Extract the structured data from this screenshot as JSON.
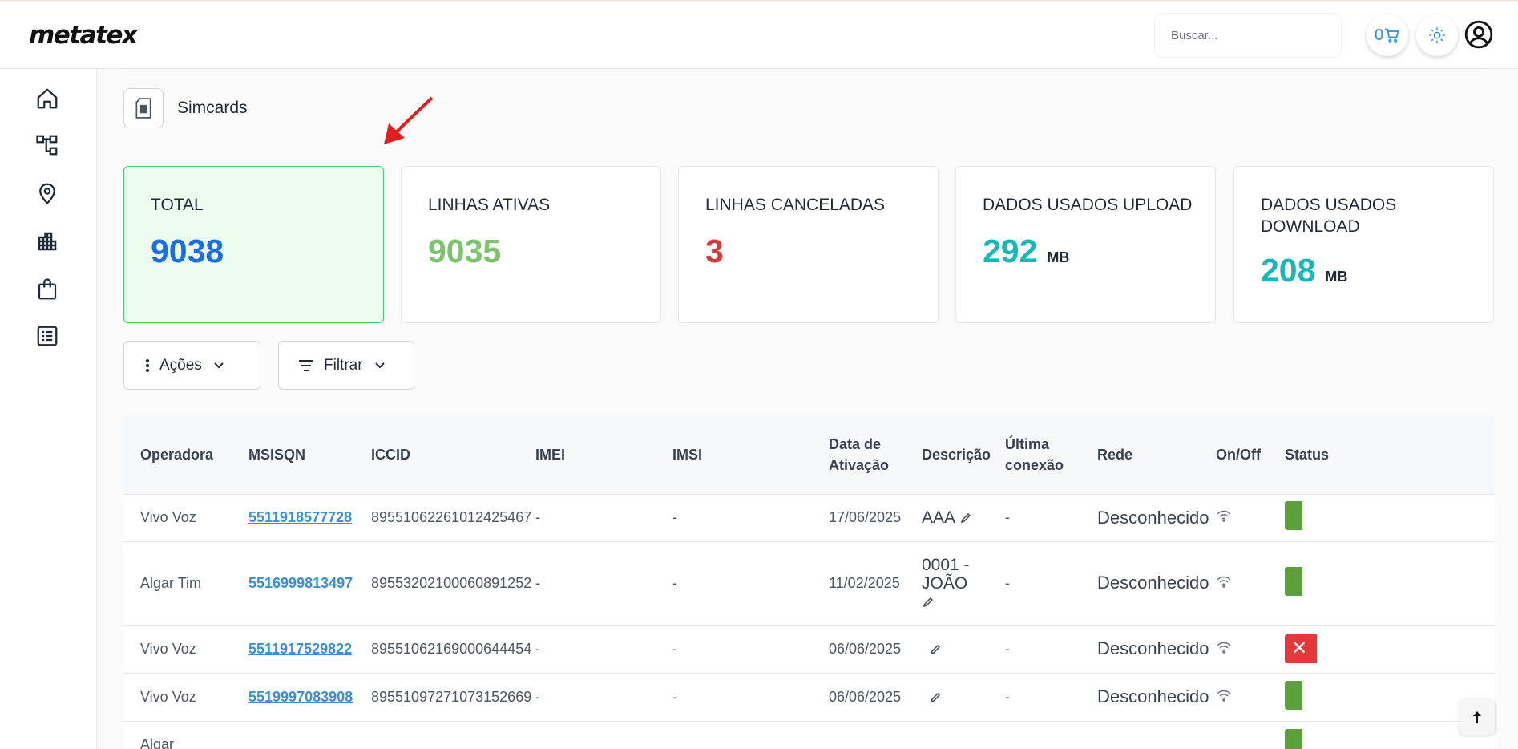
{
  "app": {
    "logo_text": "metatex"
  },
  "header": {
    "search_placeholder": "Buscar...",
    "cart_count": "0",
    "icons": [
      "cart-icon",
      "sun-icon",
      "user-circle-icon"
    ]
  },
  "sidebar": {
    "items": [
      {
        "icon": "home-icon"
      },
      {
        "icon": "network-icon"
      },
      {
        "icon": "map-pin-icon"
      },
      {
        "icon": "building-icon"
      },
      {
        "icon": "shopping-bag-icon"
      },
      {
        "icon": "list-icon"
      }
    ]
  },
  "page": {
    "title": "Simcards",
    "icon": "simcard-icon"
  },
  "cards": [
    {
      "label": "TOTAL",
      "value": "9038",
      "unit": "",
      "color": "#1a6ee6"
    },
    {
      "label": "LINHAS ATIVAS",
      "value": "9035",
      "unit": "",
      "color": "#7cc46b"
    },
    {
      "label": "LINHAS CANCELADAS",
      "value": "3",
      "unit": "",
      "color": "#d63b3b"
    },
    {
      "label": "DADOS USADOS UPLOAD",
      "value": "292",
      "unit": "MB",
      "color": "#18b8b8"
    },
    {
      "label": "DADOS USADOS DOWNLOAD",
      "value": "208",
      "unit": "MB",
      "color": "#18b8b8"
    }
  ],
  "toolbar": {
    "actions_label": "Ações",
    "filter_label": "Filtrar"
  },
  "table": {
    "columns": [
      "Operadora",
      "MSISQN",
      "ICCID",
      "IMEI",
      "IMSI",
      "Data de Ativação",
      "Descrição",
      "Última conexão",
      "Rede",
      "On/Off",
      "Status"
    ],
    "rows": [
      {
        "operadora": "Vivo Voz",
        "msisdn": "5511918577728",
        "iccid": "89551062261012425467",
        "imei": "-",
        "imsi": "-",
        "data": "17/06/2025",
        "descricao": "AAA",
        "ultima": "-",
        "rede": "Desconhecido",
        "status": "on"
      },
      {
        "operadora": "Algar Tim",
        "msisdn": "5516999813497",
        "iccid": "89553202100060891252",
        "imei": "-",
        "imsi": "-",
        "data": "11/02/2025",
        "descricao": "0001 - JOÃO",
        "ultima": "-",
        "rede": "Desconhecido",
        "status": "on"
      },
      {
        "operadora": "Vivo Voz",
        "msisdn": "5511917529822",
        "iccid": "89551062169000644454",
        "imei": "-",
        "imsi": "-",
        "data": "06/06/2025",
        "descricao": "",
        "ultima": "-",
        "rede": "Desconhecido",
        "status": "off"
      },
      {
        "operadora": "Vivo Voz",
        "msisdn": "5519997083908",
        "iccid": "89551097271073152669",
        "imei": "-",
        "imsi": "-",
        "data": "06/06/2025",
        "descricao": "",
        "ultima": "-",
        "rede": "Desconhecido",
        "status": "on"
      },
      {
        "operadora": "Algar",
        "msisdn": "",
        "iccid": "",
        "imei": "",
        "imsi": "",
        "data": "",
        "descricao": "",
        "ultima": "",
        "rede": "",
        "status": "on"
      }
    ]
  }
}
